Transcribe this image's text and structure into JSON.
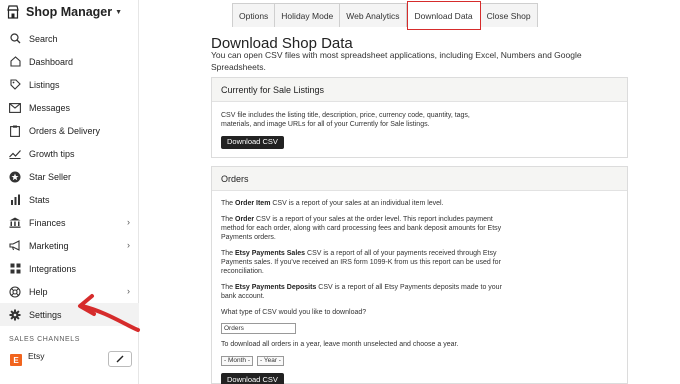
{
  "brand": {
    "title": "Shop Manager"
  },
  "sidebar": {
    "items": [
      {
        "label": "Search",
        "icon": "search-icon"
      },
      {
        "label": "Dashboard",
        "icon": "home-icon"
      },
      {
        "label": "Listings",
        "icon": "tag-icon"
      },
      {
        "label": "Messages",
        "icon": "envelope-icon"
      },
      {
        "label": "Orders & Delivery",
        "icon": "clipboard-icon"
      },
      {
        "label": "Growth tips",
        "icon": "trend-icon"
      },
      {
        "label": "Star Seller",
        "icon": "star-icon"
      },
      {
        "label": "Stats",
        "icon": "bar-chart-icon"
      },
      {
        "label": "Finances",
        "icon": "bank-icon"
      },
      {
        "label": "Marketing",
        "icon": "megaphone-icon"
      },
      {
        "label": "Integrations",
        "icon": "grid-icon"
      },
      {
        "label": "Help",
        "icon": "help-icon"
      },
      {
        "label": "Settings",
        "icon": "gear-icon"
      }
    ],
    "sales_channels_label": "SALES CHANNELS",
    "channel": {
      "badge": "E",
      "name": "Etsy"
    }
  },
  "tabs": [
    "Options",
    "Holiday Mode",
    "Web Analytics",
    "Download Data",
    "Close Shop"
  ],
  "main": {
    "title": "Download Shop Data",
    "subtitle": "You can open CSV files with most spreadsheet applications, including Excel, Numbers and Google Spreadsheets."
  },
  "listings_card": {
    "heading": "Currently for Sale Listings",
    "description": "CSV file includes the listing title, description, price, currency code, quantity, tags, materials, and image URLs for all of your Currently for Sale listings.",
    "button": "Download CSV"
  },
  "orders_card": {
    "heading": "Orders",
    "p1_bold": "Order Item",
    "p1_pre": "The ",
    "p1_post": " CSV is a report of your sales at an individual item level.",
    "p2_bold": "Order",
    "p2_pre": "The ",
    "p2_post": " CSV is a report of your sales at the order level. This report includes payment method for each order, along with card processing fees and bank deposit amounts for Etsy Payments orders.",
    "p3_bold": "Etsy Payments Sales",
    "p3_pre": "The ",
    "p3_post": " CSV is a report of all of your payments received through Etsy Payments sales. If you've received an IRS form 1099-K from us this report can be used for reconciliation.",
    "p4_bold": "Etsy Payments Deposits",
    "p4_pre": "The ",
    "p4_post": " CSV is a report of all Etsy Payments deposits made to your bank account.",
    "question": "What type of CSV would you like to download?",
    "type_value": "Orders",
    "instruction": "To download all orders in a year, leave month unselected and choose a year.",
    "month_select": "- Month -",
    "year_select": "- Year -",
    "button": "Download CSV"
  },
  "colors": {
    "highlight": "#d62c2c",
    "button": "#222222",
    "etsy": "#f1641e"
  }
}
